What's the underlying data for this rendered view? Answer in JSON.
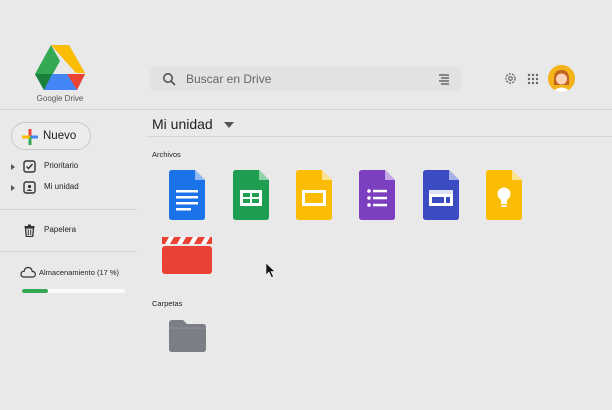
{
  "brand": {
    "name": "Google Drive"
  },
  "search": {
    "placeholder": "Buscar en Drive",
    "value": ""
  },
  "header": {
    "icons": [
      "search-icon",
      "filter-icon",
      "settings-icon",
      "apps-grid-icon",
      "avatar"
    ]
  },
  "sidebar": {
    "new_label": "Nuevo",
    "items": [
      {
        "label": "Prioritario",
        "icon": "checkbox-icon"
      },
      {
        "label": "Mi unidad",
        "icon": "my-drive-icon"
      },
      {
        "label": "Papelera",
        "icon": "trash-icon"
      }
    ],
    "storage": {
      "label": "Almacenamiento (17 %)",
      "percent": 17
    }
  },
  "main": {
    "title": "Mi unidad",
    "files_label": "Archivos",
    "folders_label": "Carpetas",
    "files": [
      {
        "type": "docs",
        "color": "#1a73e8"
      },
      {
        "type": "sheets",
        "color": "#1e9e50"
      },
      {
        "type": "slides",
        "color": "#fbbc04"
      },
      {
        "type": "forms",
        "color": "#7b3fbf"
      },
      {
        "type": "sites",
        "color": "#3b4bc1"
      },
      {
        "type": "keep",
        "color": "#fbbc04"
      },
      {
        "type": "video",
        "color": "#ea4335"
      }
    ],
    "folders": [
      {
        "type": "folder",
        "color": "#7b7e85"
      }
    ]
  }
}
